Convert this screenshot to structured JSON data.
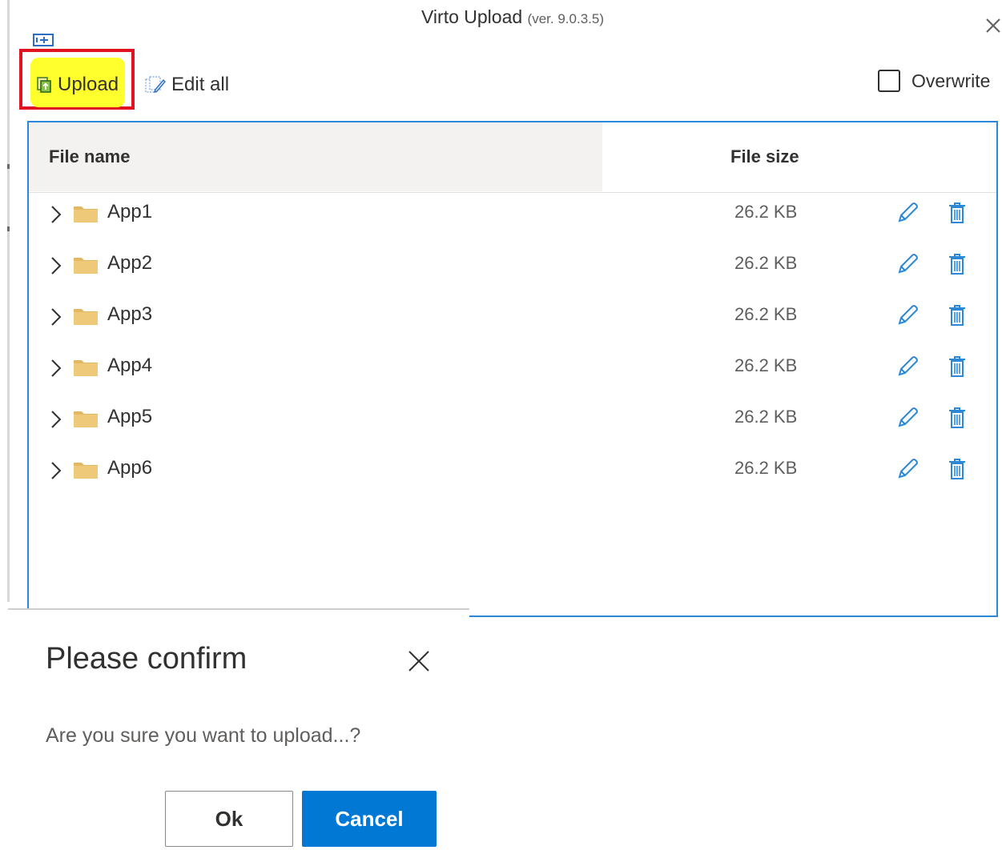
{
  "window": {
    "title": "Virto Upload",
    "version": "(ver. 9.0.3.5)"
  },
  "toolbar": {
    "upload_label": "Upload",
    "edit_all_label": "Edit all",
    "overwrite_label": "Overwrite",
    "overwrite_checked": false
  },
  "grid": {
    "columns": {
      "name": "File name",
      "size": "File size"
    },
    "rows": [
      {
        "name": "App1",
        "size": "26.2 KB"
      },
      {
        "name": "App2",
        "size": "26.2 KB"
      },
      {
        "name": "App3",
        "size": "26.2 KB"
      },
      {
        "name": "App4",
        "size": "26.2 KB"
      },
      {
        "name": "App5",
        "size": "26.2 KB"
      },
      {
        "name": "App6",
        "size": "26.2 KB"
      }
    ]
  },
  "dialog": {
    "title": "Please confirm",
    "message": "Are you sure you want to upload...?",
    "ok_label": "Ok",
    "cancel_label": "Cancel"
  },
  "colors": {
    "accent": "#0078d4",
    "highlight_box": "#e0141e",
    "highlight_marker": "#ffff2e",
    "folder": "#efc97a",
    "icon_blue": "#2b88d8"
  },
  "icons": {
    "close": "close-icon",
    "expand": "expand-panel-icon",
    "upload": "upload-icon",
    "edit_all": "edit-all-icon",
    "chevron": "chevron-right-icon",
    "folder": "folder-icon",
    "edit": "pencil-icon",
    "delete": "trash-icon"
  }
}
